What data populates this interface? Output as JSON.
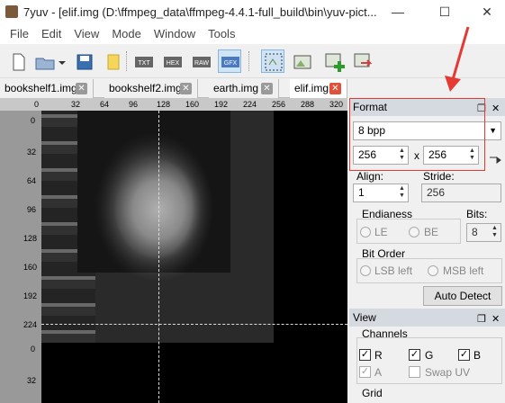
{
  "window": {
    "title": "7yuv - [elif.img (D:\\ffmpeg_data\\ffmpeg-4.4.1-full_build\\bin\\yuv-pict..."
  },
  "menu": [
    "File",
    "Edit",
    "View",
    "Mode",
    "Window",
    "Tools"
  ],
  "toolbar": {
    "txt": "TXT",
    "hex": "HEX",
    "raw": "RAW",
    "gfx": "GFX"
  },
  "tabs": [
    {
      "label": "bookshelf1.img"
    },
    {
      "label": "bookshelf2.img"
    },
    {
      "label": "earth.img"
    },
    {
      "label": "elif.img",
      "active": true
    }
  ],
  "rulers": {
    "h": [
      "0",
      "32",
      "64",
      "96",
      "128",
      "160",
      "192",
      "224",
      "256",
      "288",
      "320"
    ],
    "v": [
      "0",
      "32",
      "64",
      "96",
      "128",
      "160",
      "192",
      "224",
      "0",
      "32"
    ]
  },
  "format_panel": {
    "title": "Format",
    "format_value": "8 bpp",
    "width": "256",
    "height": "256",
    "x_sep": "x",
    "align_label": "Align:",
    "align_value": "1",
    "stride_label": "Stride:",
    "stride_value": "256",
    "endianess_label": "Endianess",
    "le_label": "LE",
    "be_label": "BE",
    "bits_label": "Bits:",
    "bits_value": "8",
    "bit_order_label": "Bit Order",
    "lsb_label": "LSB left",
    "msb_label": "MSB left",
    "auto_detect": "Auto Detect"
  },
  "view_panel": {
    "title": "View",
    "channels_label": "Channels",
    "r_label": "R",
    "g_label": "G",
    "b_label": "B",
    "a_label": "A",
    "swap_uv_label": "Swap UV",
    "grid_label": "Grid"
  },
  "colors": {
    "highlight": "#e53935",
    "arrow": "#e53935"
  }
}
